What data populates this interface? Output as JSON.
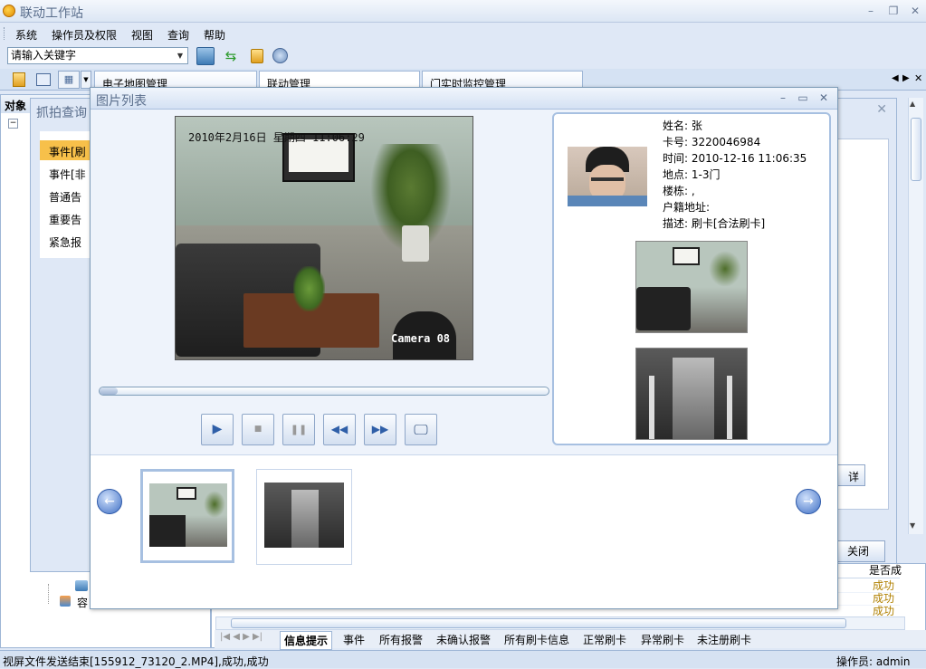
{
  "app": {
    "title": "联动工作站"
  },
  "menu": [
    "系统",
    "操作员及权限",
    "视图",
    "查询",
    "帮助"
  ],
  "toolbar": {
    "search_value": "请输入关键字"
  },
  "tabs": [
    "电子地图管理",
    "联动管理",
    "门实时监控管理"
  ],
  "left_panel": {
    "header": "对象",
    "tree_item": "容"
  },
  "bg_dialog": {
    "title": "抓拍查询",
    "items": [
      "事件[刷",
      "事件[非",
      "普通告",
      "重要告",
      "紧急报"
    ],
    "close_btn": "关闭",
    "btn_partial": "详"
  },
  "dialog": {
    "title": "图片列表",
    "video_overlay": {
      "timestamp": "2010年2月16日  星期四  11:06:29",
      "camera": "Camera 08"
    },
    "info": {
      "name": "姓名: 张",
      "card": "卡号: 3220046984",
      "time": "时间: 2010-12-16 11:06:35",
      "location": "地点: 1-3门",
      "building": "楼栋: ,",
      "address": "户籍地址:",
      "desc": "描述: 刷卡[合法刷卡]"
    },
    "progress": 0.04
  },
  "grid": {
    "col_header": "是否成",
    "status": [
      "成功",
      "成功",
      "成功"
    ]
  },
  "bottom_tabs": [
    "信息提示",
    "事件",
    "所有报警",
    "未确认报警",
    "所有刷卡信息",
    "正常刷卡",
    "异常刷卡",
    "未注册刷卡"
  ],
  "status": {
    "message": "视屏文件发送结束[155912_73120_2.MP4],成功,成功",
    "operator": "操作员: admin"
  }
}
